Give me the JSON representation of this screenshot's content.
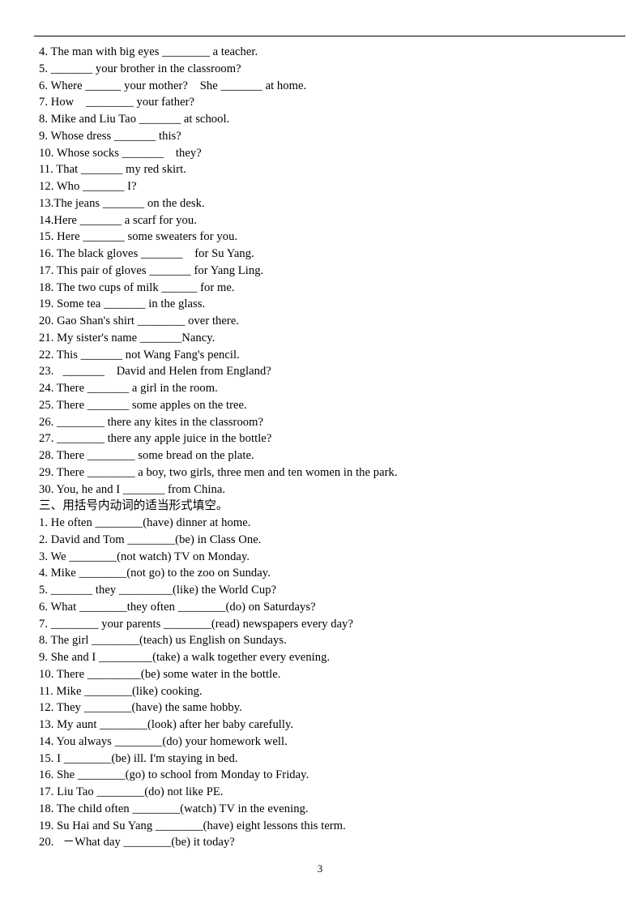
{
  "document": {
    "page_number": "3",
    "has_top_rule": true
  },
  "section_two_continued": {
    "items": [
      "4. The man with big eyes ________ a teacher.",
      "5. _______ your brother in the classroom?",
      "6. Where ______ your mother?    She _______ at home.",
      "7. How    ________ your father?",
      "8. Mike and Liu Tao _______ at school.",
      "9. Whose dress _______ this?",
      "10. Whose socks _______    they?",
      "11. That _______ my red skirt.",
      "12. Who _______ I?",
      "13.The jeans _______ on the desk.",
      "14.Here _______ a scarf for you.",
      "15. Here _______ some sweaters for you.",
      "16. The black gloves _______    for Su Yang.",
      "17. This pair of gloves _______ for Yang Ling.",
      "18. The two cups of milk ______ for me.",
      "19. Some tea _______ in the glass.",
      "20. Gao Shan's shirt ________ over there.",
      "21. My sister's name _______Nancy.",
      "22. This _______ not Wang Fang's pencil.",
      "23.   _______    David and Helen from England?",
      "24. There _______ a girl in the room.",
      "25. There _______ some apples on the tree.",
      "26. ________ there any kites in the classroom?",
      "27. ________ there any apple juice in the bottle?",
      "28. There ________ some bread on the plate.",
      "29. There ________ a boy, two girls, three men and ten women in the park.",
      "30. You, he and I _______ from China."
    ]
  },
  "section_three": {
    "heading": "三、用括号内动词的适当形式填空。",
    "items": [
      "1. He often ________(have) dinner at home.",
      "2. David and Tom ________(be) in Class One.",
      "3. We ________(not watch) TV on Monday.",
      "4. Mike ________(not go) to the zoo on Sunday.",
      "5. _______ they _________(like) the World Cup?",
      "6. What ________they often ________(do) on Saturdays?",
      "7. ________ your parents ________(read) newspapers every day?",
      "8. The girl ________(teach) us English on Sundays.",
      "9. She and I _________(take) a walk together every evening.",
      "10. There _________(be) some water in the bottle.",
      "11. Mike ________(like) cooking.",
      "12. They ________(have) the same hobby.",
      "13. My aunt ________(look) after her baby carefully.",
      "14. You always ________(do) your homework well.",
      "15. I ________(be) ill. I'm staying in bed.",
      "16. She ________(go) to school from Monday to Friday.",
      "17. Liu Tao ________(do) not like PE.",
      "18. The child often ________(watch) TV in the evening.",
      "19. Su Hai and Su Yang ________(have) eight lessons this term.",
      "20.   －What day ________(be) it today?"
    ]
  }
}
